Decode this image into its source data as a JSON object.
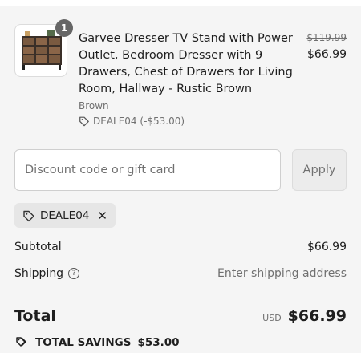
{
  "cart_item": {
    "quantity": "1",
    "title": "Garvee Dresser TV Stand with Power Outlet, Bedroom Dresser with 9 Drawers, Chest of Drawers for Living Room, Hallway - Rustic Brown",
    "variant": "Brown",
    "discount_line": "DEALE04 (-$53.00)",
    "price_original": "$119.99",
    "price_current": "$66.99",
    "image_icon": "dresser-thumbnail"
  },
  "discount": {
    "placeholder": "Discount code or gift card",
    "apply_label": "Apply",
    "applied_code": "DEALE04"
  },
  "summary": {
    "subtotal_label": "Subtotal",
    "subtotal_value": "$66.99",
    "shipping_label": "Shipping",
    "shipping_value": "Enter shipping address",
    "total_label": "Total",
    "currency": "USD",
    "total_value": "$66.99",
    "savings_label": "TOTAL SAVINGS",
    "savings_value": "$53.00"
  },
  "colors": {
    "panel_bg": "#f5f5f5",
    "text": "#1f1f1f",
    "muted": "#707070",
    "badge": "#666666"
  }
}
